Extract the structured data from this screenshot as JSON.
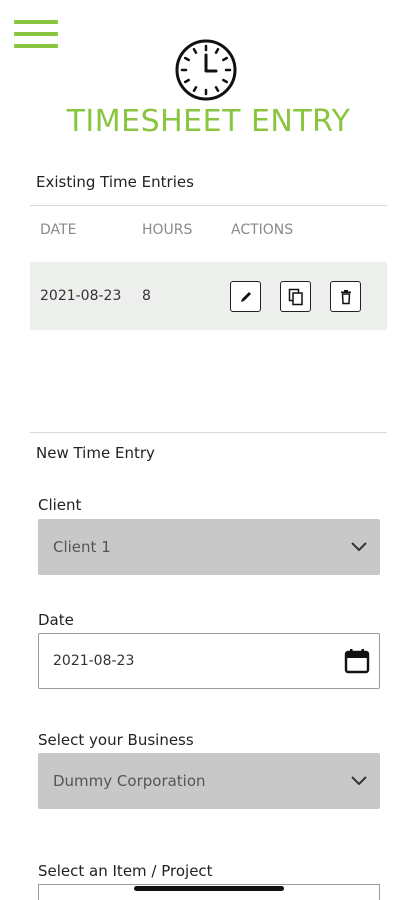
{
  "header": {
    "title": "TIMESHEET ENTRY",
    "menu_icon": "hamburger-menu-icon",
    "logo_icon": "clock-icon",
    "accent_color": "#8ac53f"
  },
  "existing": {
    "section_title": "Existing Time Entries",
    "columns": [
      "DATE",
      "HOURS",
      "ACTIONS"
    ],
    "rows": [
      {
        "date": "2021-08-23",
        "hours": "8",
        "actions": [
          "edit-icon",
          "copy-icon",
          "delete-icon"
        ]
      }
    ]
  },
  "new_entry": {
    "section_title": "New Time Entry",
    "client": {
      "label": "Client",
      "value": "Client 1"
    },
    "date": {
      "label": "Date",
      "value": "2021-08-23"
    },
    "business": {
      "label": "Select your Business",
      "value": "Dummy Corporation"
    },
    "project": {
      "label": "Select an Item / Project"
    }
  }
}
